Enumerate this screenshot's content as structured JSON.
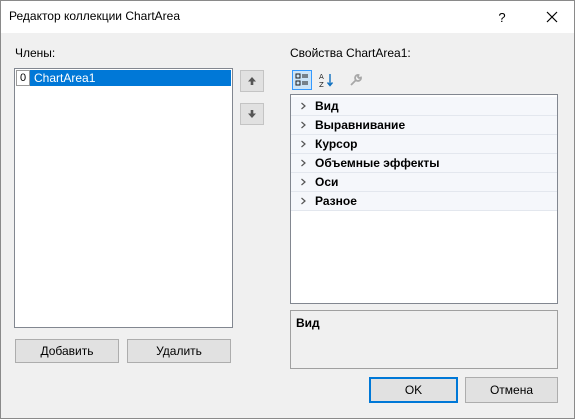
{
  "window": {
    "title": "Редактор коллекции ChartArea",
    "help_symbol": "?"
  },
  "members": {
    "label": "Члены:",
    "items": [
      {
        "index": "0",
        "name": "ChartArea1"
      }
    ],
    "move_up_icon": "arrow-up-icon",
    "move_down_icon": "arrow-down-icon"
  },
  "buttons": {
    "add": "Добавить",
    "remove": "Удалить",
    "ok": "OK",
    "cancel": "Отмена"
  },
  "properties": {
    "label": "Свойства ChartArea1:",
    "toolbar": [
      "categorized-icon",
      "alphabetical-icon",
      "property-pages-icon"
    ],
    "categories": [
      {
        "label": "Вид"
      },
      {
        "label": "Выравнивание"
      },
      {
        "label": "Курсор"
      },
      {
        "label": "Объемные эффекты"
      },
      {
        "label": "Оси"
      },
      {
        "label": "Разное"
      }
    ],
    "description_title": "Вид"
  },
  "colors": {
    "selection": "#0078d7",
    "button_face": "#e1e1e1",
    "dialog_bg": "#f0f0f0"
  }
}
